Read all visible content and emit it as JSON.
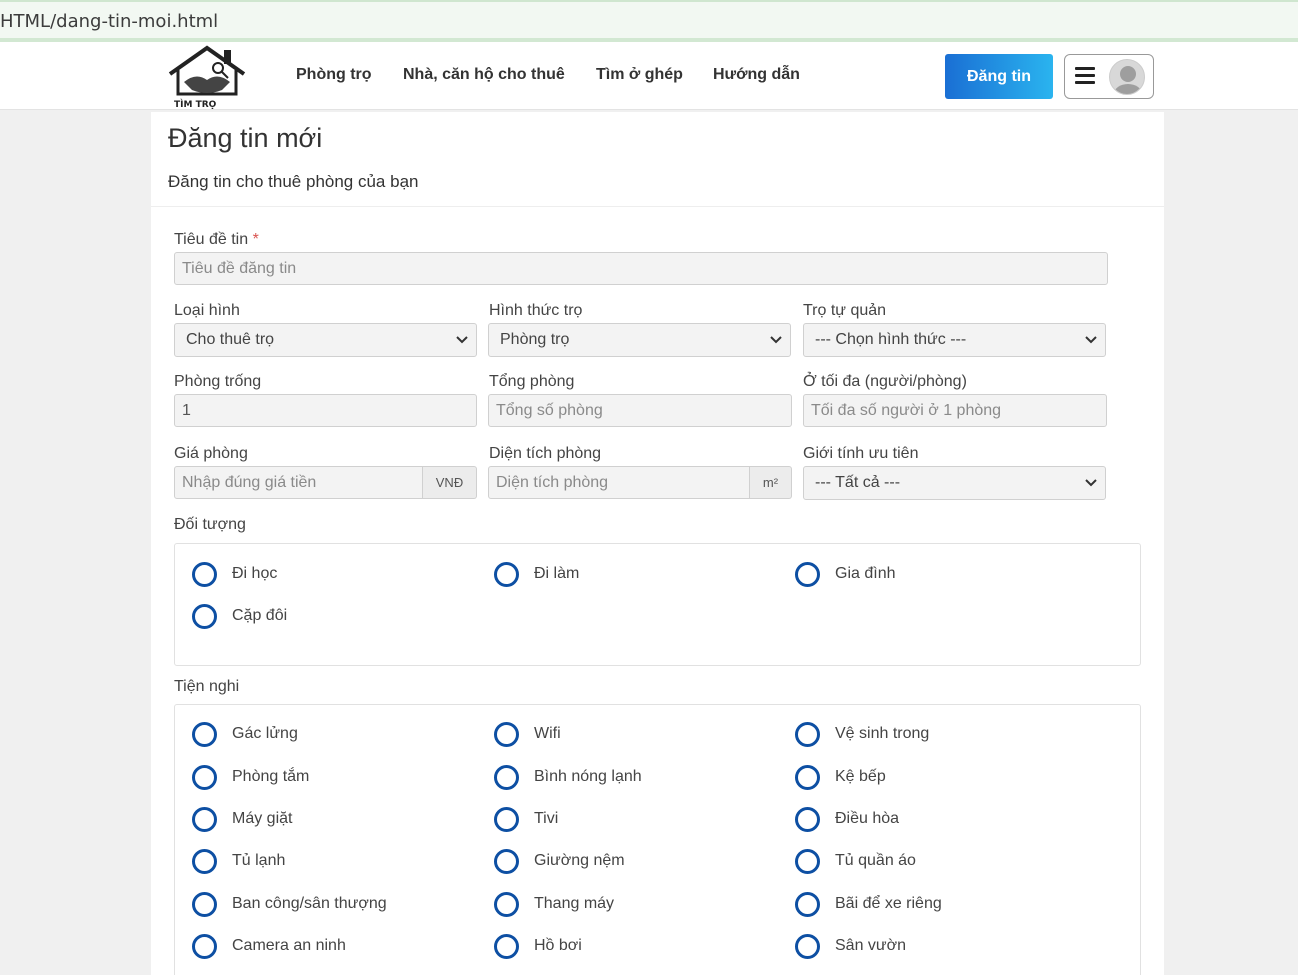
{
  "browser": {
    "url": "HTML/dang-tin-moi.html"
  },
  "header": {
    "logo_text": "TÌM TRỌ",
    "nav": [
      "Phòng trọ",
      "Nhà, căn hộ cho thuê",
      "Tìm ở ghép",
      "Hướng dẫn"
    ],
    "post_button": "Đăng tin"
  },
  "page": {
    "title": "Đăng tin mới",
    "subtitle": "Đăng tin cho thuê phòng của bạn"
  },
  "form": {
    "title_label": "Tiêu đề tin",
    "required_mark": "*",
    "title_placeholder": "Tiêu đề đăng tin",
    "type_label": "Loại hình",
    "type_value": "Cho thuê trọ",
    "form_label": "Hình thức trọ",
    "form_value": "Phòng trọ",
    "self_label": "Trọ tự quản",
    "self_value": "--- Chọn hình thức ---",
    "vacant_label": "Phòng trống",
    "vacant_value": "1",
    "total_label": "Tổng phòng",
    "total_placeholder": "Tổng số phòng",
    "max_label": "Ở tối đa (người/phòng)",
    "max_placeholder": "Tối đa số người ở 1 phòng",
    "price_label": "Giá phòng",
    "price_placeholder": "Nhập đúng giá tiền",
    "price_unit": "VNĐ",
    "area_label": "Diện tích phòng",
    "area_placeholder": "Diện tích phòng",
    "area_unit": "m²",
    "gender_label": "Giới tính ưu tiên",
    "gender_value": "--- Tất cả ---",
    "audience_label": "Đối tượng",
    "audience": [
      "Đi học",
      "Đi làm",
      "Gia đình",
      "Cặp đôi"
    ],
    "amenities_label": "Tiện nghi",
    "amenities": [
      "Gác lửng",
      "Wifi",
      "Vệ sinh trong",
      "Phòng tắm",
      "Bình nóng lạnh",
      "Kệ bếp",
      "Máy giặt",
      "Tivi",
      "Điều hòa",
      "Tủ lạnh",
      "Giường nệm",
      "Tủ quần áo",
      "Ban công/sân thượng",
      "Thang máy",
      "Bãi để xe riêng",
      "Camera an ninh",
      "Hồ bơi",
      "Sân vườn"
    ]
  },
  "colors": {
    "accent": "#1a6fd4",
    "radio": "#0d4fa3"
  }
}
